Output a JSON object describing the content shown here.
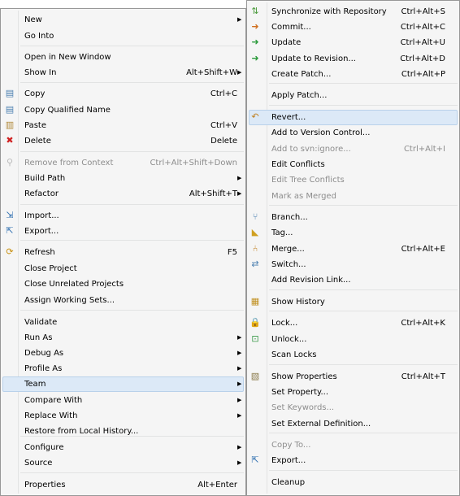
{
  "menu1": {
    "items": [
      {
        "label": "New",
        "shortcut": "",
        "arrow": true,
        "icon": "",
        "disabled": false
      },
      {
        "label": "Go Into",
        "shortcut": "",
        "arrow": false,
        "icon": "",
        "disabled": false
      },
      {
        "label": "Open in New Window",
        "shortcut": "",
        "arrow": false,
        "icon": "",
        "disabled": false
      },
      {
        "label": "Show In",
        "shortcut": "Alt+Shift+W",
        "arrow": true,
        "icon": "",
        "disabled": false
      },
      {
        "label": "Copy",
        "shortcut": "Ctrl+C",
        "arrow": false,
        "icon": "copy-icon",
        "disabled": false
      },
      {
        "label": "Copy Qualified Name",
        "shortcut": "",
        "arrow": false,
        "icon": "copy-qualified-name-icon",
        "disabled": false
      },
      {
        "label": "Paste",
        "shortcut": "Ctrl+V",
        "arrow": false,
        "icon": "paste-icon",
        "disabled": false
      },
      {
        "label": "Delete",
        "shortcut": "Delete",
        "arrow": false,
        "icon": "delete-icon",
        "disabled": false
      },
      {
        "label": "Remove from Context",
        "shortcut": "Ctrl+Alt+Shift+Down",
        "arrow": false,
        "icon": "remove-from-context-icon",
        "disabled": true
      },
      {
        "label": "Build Path",
        "shortcut": "",
        "arrow": true,
        "icon": "",
        "disabled": false
      },
      {
        "label": "Refactor",
        "shortcut": "Alt+Shift+T",
        "arrow": true,
        "icon": "",
        "disabled": false
      },
      {
        "label": "Import...",
        "shortcut": "",
        "arrow": false,
        "icon": "import-icon",
        "disabled": false
      },
      {
        "label": "Export...",
        "shortcut": "",
        "arrow": false,
        "icon": "export-icon",
        "disabled": false
      },
      {
        "label": "Refresh",
        "shortcut": "F5",
        "arrow": false,
        "icon": "refresh-icon",
        "disabled": false
      },
      {
        "label": "Close Project",
        "shortcut": "",
        "arrow": false,
        "icon": "",
        "disabled": false
      },
      {
        "label": "Close Unrelated Projects",
        "shortcut": "",
        "arrow": false,
        "icon": "",
        "disabled": false
      },
      {
        "label": "Assign Working Sets...",
        "shortcut": "",
        "arrow": false,
        "icon": "",
        "disabled": false
      },
      {
        "label": "Validate",
        "shortcut": "",
        "arrow": false,
        "icon": "",
        "disabled": false
      },
      {
        "label": "Run As",
        "shortcut": "",
        "arrow": true,
        "icon": "",
        "disabled": false
      },
      {
        "label": "Debug As",
        "shortcut": "",
        "arrow": true,
        "icon": "",
        "disabled": false
      },
      {
        "label": "Profile As",
        "shortcut": "",
        "arrow": true,
        "icon": "",
        "disabled": false
      },
      {
        "label": "Team",
        "shortcut": "",
        "arrow": true,
        "icon": "",
        "disabled": false,
        "highlighted": true
      },
      {
        "label": "Compare With",
        "shortcut": "",
        "arrow": true,
        "icon": "",
        "disabled": false
      },
      {
        "label": "Replace With",
        "shortcut": "",
        "arrow": true,
        "icon": "",
        "disabled": false
      },
      {
        "label": "Restore from Local History...",
        "shortcut": "",
        "arrow": false,
        "icon": "",
        "disabled": false
      },
      {
        "label": "Configure",
        "shortcut": "",
        "arrow": true,
        "icon": "",
        "disabled": false
      },
      {
        "label": "Source",
        "shortcut": "",
        "arrow": true,
        "icon": "",
        "disabled": false
      },
      {
        "label": "Properties",
        "shortcut": "Alt+Enter",
        "arrow": false,
        "icon": "",
        "disabled": false
      }
    ]
  },
  "menu2": {
    "items": [
      {
        "label": "Synchronize with Repository",
        "shortcut": "Ctrl+Alt+S",
        "icon": "synchronize-icon",
        "disabled": false
      },
      {
        "label": "Commit...",
        "shortcut": "Ctrl+Alt+C",
        "icon": "commit-icon",
        "disabled": false
      },
      {
        "label": "Update",
        "shortcut": "Ctrl+Alt+U",
        "icon": "update-icon",
        "disabled": false
      },
      {
        "label": "Update to Revision...",
        "shortcut": "Ctrl+Alt+D",
        "icon": "update-to-revision-icon",
        "disabled": false
      },
      {
        "label": "Create Patch...",
        "shortcut": "Ctrl+Alt+P",
        "icon": "",
        "disabled": false
      },
      {
        "label": "Apply Patch...",
        "shortcut": "",
        "icon": "",
        "disabled": false
      },
      {
        "label": "Revert...",
        "shortcut": "",
        "icon": "revert-icon",
        "disabled": false,
        "highlighted": true
      },
      {
        "label": "Add to Version Control...",
        "shortcut": "",
        "icon": "",
        "disabled": false
      },
      {
        "label": "Add to svn:ignore...",
        "shortcut": "Ctrl+Alt+I",
        "icon": "",
        "disabled": true
      },
      {
        "label": "Edit Conflicts",
        "shortcut": "",
        "icon": "",
        "disabled": false
      },
      {
        "label": "Edit Tree Conflicts",
        "shortcut": "",
        "icon": "",
        "disabled": true
      },
      {
        "label": "Mark as Merged",
        "shortcut": "",
        "icon": "",
        "disabled": true
      },
      {
        "label": "Branch...",
        "shortcut": "",
        "icon": "branch-icon",
        "disabled": false
      },
      {
        "label": "Tag...",
        "shortcut": "",
        "icon": "tag-icon",
        "disabled": false
      },
      {
        "label": "Merge...",
        "shortcut": "Ctrl+Alt+E",
        "icon": "merge-icon",
        "disabled": false
      },
      {
        "label": "Switch...",
        "shortcut": "",
        "icon": "switch-icon",
        "disabled": false
      },
      {
        "label": "Add Revision Link...",
        "shortcut": "",
        "icon": "",
        "disabled": false
      },
      {
        "label": "Show History",
        "shortcut": "",
        "icon": "show-history-icon",
        "disabled": false
      },
      {
        "label": "Lock...",
        "shortcut": "Ctrl+Alt+K",
        "icon": "lock-icon",
        "disabled": false
      },
      {
        "label": "Unlock...",
        "shortcut": "",
        "icon": "unlock-icon",
        "disabled": false
      },
      {
        "label": "Scan Locks",
        "shortcut": "",
        "icon": "",
        "disabled": false
      },
      {
        "label": "Show Properties",
        "shortcut": "Ctrl+Alt+T",
        "icon": "show-properties-icon",
        "disabled": false
      },
      {
        "label": "Set Property...",
        "shortcut": "",
        "icon": "",
        "disabled": false
      },
      {
        "label": "Set Keywords...",
        "shortcut": "",
        "icon": "",
        "disabled": true
      },
      {
        "label": "Set External Definition...",
        "shortcut": "",
        "icon": "",
        "disabled": false
      },
      {
        "label": "Copy To...",
        "shortcut": "",
        "icon": "",
        "disabled": true
      },
      {
        "label": "Export...",
        "shortcut": "",
        "icon": "export-icon",
        "disabled": false
      },
      {
        "label": "Cleanup",
        "shortcut": "",
        "icon": "",
        "disabled": false
      }
    ]
  },
  "colors": {
    "highlight_bg": "#dce9f7",
    "highlight_border": "#b9d1ea",
    "disabled_text": "#8d8d8d",
    "menu_bg": "#f5f5f5"
  }
}
